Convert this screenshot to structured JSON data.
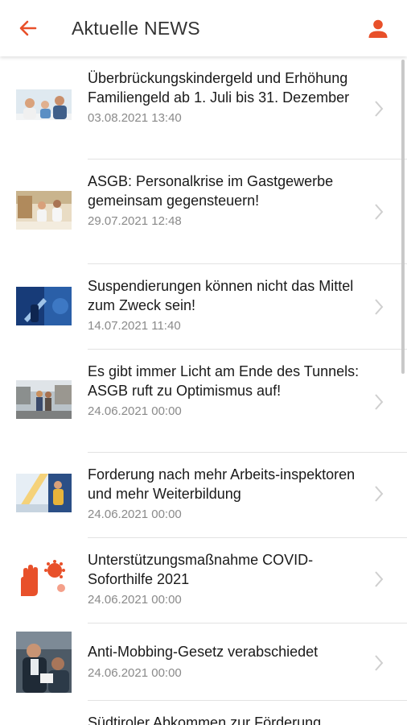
{
  "header": {
    "title": "Aktuelle NEWS",
    "back_icon": "arrow-left-icon",
    "profile_icon": "person-icon",
    "accent_color": "#e8502a"
  },
  "news": [
    {
      "title": "Überbrückungskindergeld und Erhöhung Familiengeld ab 1. Juli bis 31. Dezember",
      "date": "03.08.2021 13:40",
      "thumb": "family-photo"
    },
    {
      "title": "ASGB: Personalkrise im Gastgewerbe gemeinsam gegensteuern!",
      "date": "29.07.2021 12:48",
      "thumb": "restaurant-photo"
    },
    {
      "title": "Suspendierungen können nicht das Mittel zum Zweck sein!",
      "date": "14.07.2021 11:40",
      "thumb": "syringe-photo"
    },
    {
      "title": "Es gibt immer Licht am Ende des Tunnels: ASGB ruft zu Optimismus auf!",
      "date": "24.06.2021 00:00",
      "thumb": "street-photo"
    },
    {
      "title": "Forderung nach mehr Arbeits-inspektoren und mehr Weiterbildung",
      "date": "24.06.2021 00:00",
      "thumb": "worker-photo"
    },
    {
      "title": "Unterstützungsmaßnahme COVID-Soforthilfe 2021",
      "date": "24.06.2021 00:00",
      "thumb": "covid-hand-illustration"
    },
    {
      "title": "Anti-Mobbing-Gesetz verabschiedet",
      "date": "24.06.2021 00:00",
      "thumb": "office-photo"
    },
    {
      "title": "Südtiroler Abkommen zur Förderung",
      "date": "",
      "thumb": ""
    }
  ]
}
